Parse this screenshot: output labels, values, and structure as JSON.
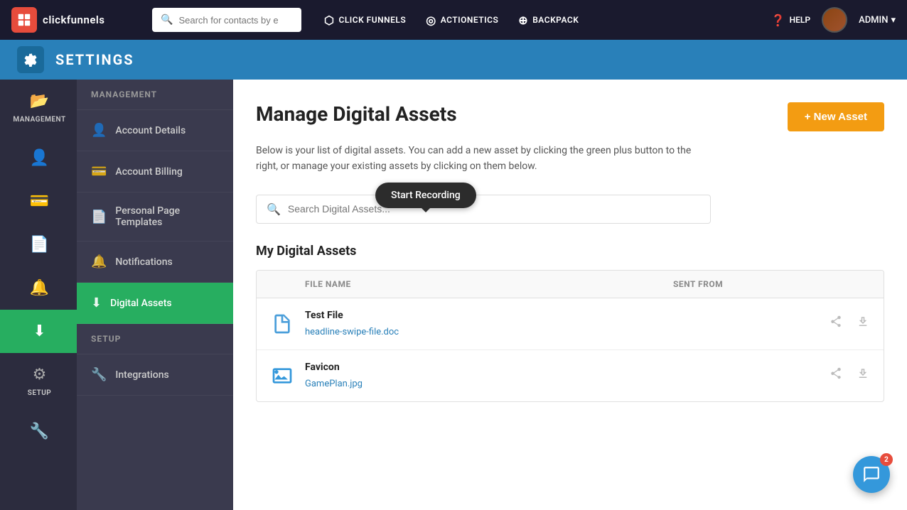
{
  "topNav": {
    "logoText": "clickfunnels",
    "searchPlaceholder": "Search for contacts by e",
    "links": [
      {
        "id": "clickfunnels",
        "label": "CLICK FUNNELS",
        "icon": "⬡"
      },
      {
        "id": "actionetics",
        "label": "ACTIONETICS",
        "icon": "◎"
      },
      {
        "id": "backpack",
        "label": "BACKPACK",
        "icon": "⊕"
      }
    ],
    "help": "HELP",
    "admin": "ADMIN"
  },
  "settingsHeader": {
    "title": "SETTINGS"
  },
  "sidebar": {
    "items": [
      {
        "id": "management",
        "icon": "📁",
        "label": "MANAGEMENT"
      },
      {
        "id": "digital-assets",
        "icon": "⬇",
        "label": "Digital Assets"
      }
    ]
  },
  "contentSidebar": {
    "items": [
      {
        "id": "management-header",
        "label": "MANAGEMENT",
        "isHeader": true
      },
      {
        "id": "account-details",
        "label": "Account Details",
        "icon": "👤"
      },
      {
        "id": "account-billing",
        "label": "Account Billing",
        "icon": "💳"
      },
      {
        "id": "personal-templates",
        "label": "Personal Page Templates",
        "icon": "📄"
      },
      {
        "id": "notifications",
        "label": "Notifications",
        "icon": "🔔"
      },
      {
        "id": "digital-assets",
        "label": "Digital Assets",
        "icon": "⬇",
        "active": true
      },
      {
        "id": "setup-header",
        "label": "SETUP",
        "isHeader": true
      },
      {
        "id": "integrations",
        "label": "Integrations",
        "icon": "🔧"
      }
    ]
  },
  "mainContent": {
    "title": "Manage Digital Assets",
    "description": "Below is your list of digital assets. You can add a new asset by clicking the green plus button to the right, or manage your existing assets by clicking on them below.",
    "newAssetButton": "+ New Asset",
    "searchPlaceholder": "Search Digital Assets...",
    "sectionTitle": "My Digital Assets",
    "tableHeaders": {
      "fileName": "FILE NAME",
      "sentFrom": "SENT FROM"
    },
    "assets": [
      {
        "id": "asset-1",
        "name": "Test File",
        "link": "headline-swipe-file.doc",
        "type": "doc",
        "sentFrom": ""
      },
      {
        "id": "asset-2",
        "name": "Favicon",
        "link": "GamePlan.jpg",
        "type": "image",
        "sentFrom": ""
      }
    ]
  },
  "recordingTooltip": "Start Recording",
  "chatBubble": {
    "badge": "2"
  }
}
